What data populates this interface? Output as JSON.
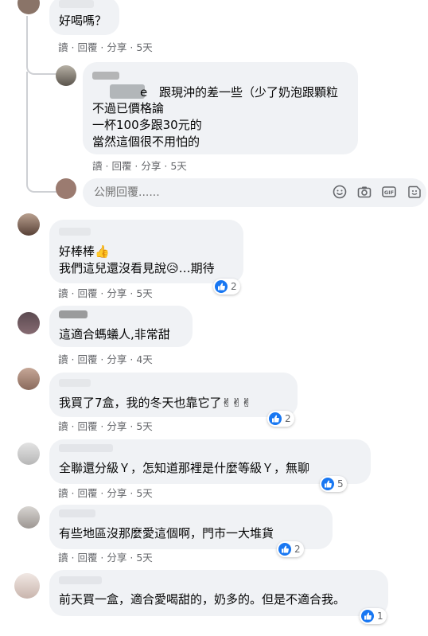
{
  "comments": [
    {
      "text_lines": [
        "好喝嗎？"
      ],
      "meta": {
        "read": "讀",
        "reply": "回覆",
        "share": "分享",
        "time": "5天"
      }
    },
    {
      "name_fragment": "e",
      "text_lines": [
        "跟現沖的差一些（少了奶泡跟顆粒",
        "不過已價格論",
        "一杯100多跟30元的",
        "當然這個很不用怕的"
      ],
      "meta": {
        "read": "讀",
        "reply": "回覆",
        "share": "分享",
        "time": "5天"
      }
    },
    {
      "text_lines": [
        "好棒棒👍",
        "我們這兒還沒看見說😥…期待"
      ],
      "reactions": "2",
      "meta": {
        "read": "讀",
        "reply": "回覆",
        "share": "分享",
        "time": "5天"
      }
    },
    {
      "text_lines": [
        "這適合螞蟻人,非常甜"
      ],
      "meta": {
        "read": "讀",
        "reply": "回覆",
        "share": "分享",
        "time": "4天"
      }
    },
    {
      "text_lines": [
        "我買了7盒，我的冬天也靠它了✌✌✌"
      ],
      "reactions": "2",
      "meta": {
        "read": "讀",
        "reply": "回覆",
        "share": "分享",
        "time": "5天"
      }
    },
    {
      "text_lines": [
        "全聯還分級Ｙ，怎知道那裡是什麼等級Ｙ，無聊"
      ],
      "reactions": "5",
      "meta": {
        "read": "讀",
        "reply": "回覆",
        "share": "分享",
        "time": "5天"
      }
    },
    {
      "text_lines": [
        "有些地區沒那麼愛這個啊，門市一大堆貨"
      ],
      "reactions": "2",
      "meta": {
        "read": "讀",
        "reply": "回覆",
        "share": "分享",
        "time": "5天"
      }
    },
    {
      "text_lines": [
        "前天買一盒，適合愛喝甜的，奶多的。但是不適合我。"
      ],
      "reactions": "1"
    }
  ],
  "reply_box": {
    "placeholder": "公開回覆......"
  },
  "colors": {
    "accent": "#1877f2",
    "bubble": "#f0f2f5",
    "meta": "#65676b"
  }
}
